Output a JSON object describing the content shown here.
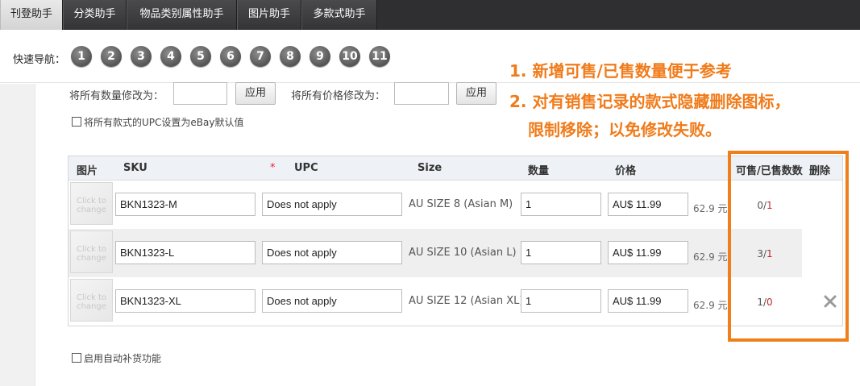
{
  "tabs": [
    {
      "label": "刊登助手",
      "active": true
    },
    {
      "label": "分类助手",
      "active": false
    },
    {
      "label": "物品类别属性助手",
      "active": false
    },
    {
      "label": "图片助手",
      "active": false
    },
    {
      "label": "多款式助手",
      "active": false
    }
  ],
  "quick_nav": {
    "label": "快速导航：",
    "items": [
      "1",
      "2",
      "3",
      "4",
      "5",
      "6",
      "7",
      "8",
      "9",
      "10",
      "11"
    ]
  },
  "batch": {
    "qty_label": "将所有数量修改为：",
    "qty_value": "",
    "qty_apply": "应用",
    "price_label": "将所有价格修改为：",
    "price_value": "",
    "price_apply": "应用",
    "upc_checkbox_label": "将所有款式的UPC设置为eBay默认值",
    "upc_checked": false
  },
  "annotation": {
    "line1": "1. 新增可售/已售数量便于参考",
    "line2": "2. 对有销售记录的款式隐藏删除图标，",
    "line3": "限制移除；以免修改失败。",
    "color": "#ef7f1a"
  },
  "table": {
    "headers": {
      "image": "图片",
      "sku": "SKU",
      "required_mark": "*",
      "upc": "UPC",
      "size": "Size",
      "qty": "数量",
      "price": "价格",
      "avail_sold": "可售/已售数数",
      "delete": "删除"
    },
    "thumb_text": [
      "Click to",
      "change"
    ],
    "rows": [
      {
        "sku": "BKN1323-M",
        "upc": "Does not apply",
        "size": "AU SIZE 8 (Asian M)",
        "qty": "1",
        "price": "AU$ 11.99",
        "yuan": "62.9 元",
        "available": "0",
        "sold": "1",
        "deletable": false
      },
      {
        "sku": "BKN1323-L",
        "upc": "Does not apply",
        "size": "AU SIZE 10 (Asian L)",
        "qty": "1",
        "price": "AU$ 11.99",
        "yuan": "62.9 元",
        "available": "3",
        "sold": "1",
        "deletable": false
      },
      {
        "sku": "BKN1323-XL",
        "upc": "Does not apply",
        "size": "AU SIZE 12 (Asian XL)",
        "qty": "1",
        "price": "AU$ 11.99",
        "yuan": "62.9 元",
        "available": "1",
        "sold": "0",
        "deletable": true
      }
    ]
  },
  "auto_restock": {
    "label": "启用自动补货功能",
    "checked": false
  },
  "colors": {
    "tabbar": "#2f2f31",
    "accent_orange": "#ef7f1a",
    "sold_red": "#c2282b"
  }
}
